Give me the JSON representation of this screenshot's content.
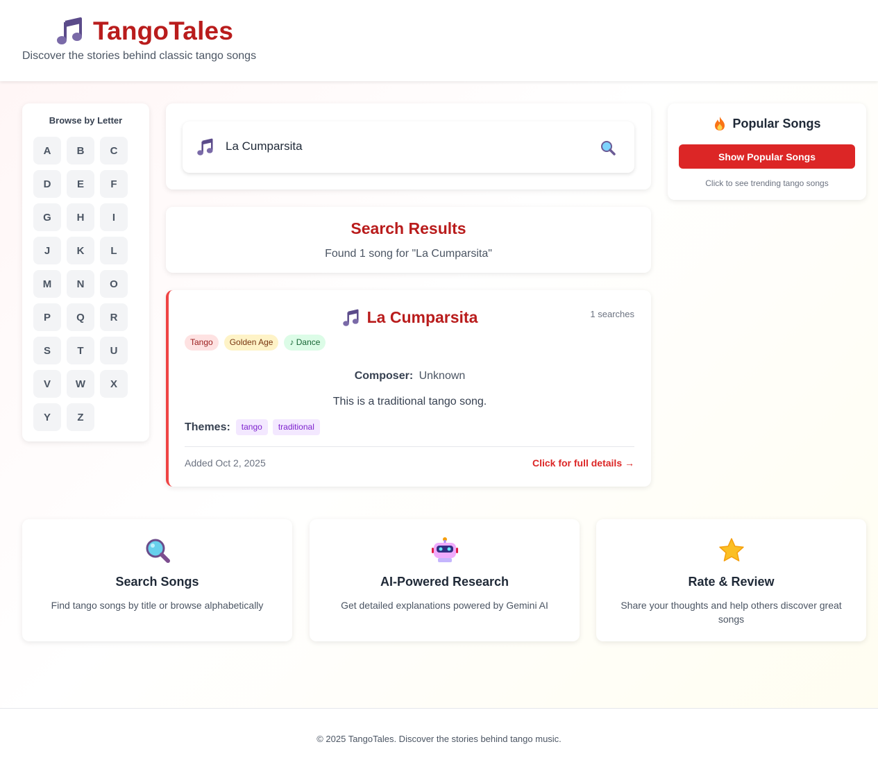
{
  "header": {
    "title": "TangoTales",
    "tagline": "Discover the stories behind classic tango songs",
    "logo_icon": "music-note-icon"
  },
  "sidebar": {
    "title": "Browse by Letter",
    "letters": [
      "A",
      "B",
      "C",
      "D",
      "E",
      "F",
      "G",
      "H",
      "I",
      "J",
      "K",
      "L",
      "M",
      "N",
      "O",
      "P",
      "Q",
      "R",
      "S",
      "T",
      "U",
      "V",
      "W",
      "X",
      "Y",
      "Z"
    ]
  },
  "search": {
    "value": "La Cumparsita",
    "placeholder": "",
    "button_icon": "search-icon"
  },
  "results": {
    "title": "Search Results",
    "count_text": "Found 1 song for \"La Cumparsita\""
  },
  "song": {
    "title": "La Cumparsita",
    "search_count": "1 searches",
    "tags": [
      "Tango",
      "Golden Age",
      "♪ Dance"
    ],
    "composer_label": "Composer:",
    "composer_value": "Unknown",
    "description": "This is a traditional tango song.",
    "themes_label": "Themes:",
    "themes": [
      "tango",
      "traditional"
    ],
    "added": "Added Oct 2, 2025",
    "details_link": "Click for full details →"
  },
  "popular": {
    "title": "Popular Songs",
    "button": "Show Popular Songs",
    "hint": "Click to see trending tango songs",
    "icon": "fire-icon"
  },
  "features": [
    {
      "icon": "magnifier-icon",
      "title": "Search Songs",
      "desc": "Find tango songs by title or browse alphabetically"
    },
    {
      "icon": "robot-icon",
      "title": "AI-Powered Research",
      "desc": "Get detailed explanations powered by Gemini AI"
    },
    {
      "icon": "star-icon",
      "title": "Rate & Review",
      "desc": "Share your thoughts and help others discover great songs"
    }
  ],
  "footer": {
    "text": "© 2025 TangoTales. Discover the stories behind tango music."
  },
  "colors": {
    "brand": "#b91c1c",
    "accent": "#dc2626",
    "note_icon": "#6b5b95"
  }
}
